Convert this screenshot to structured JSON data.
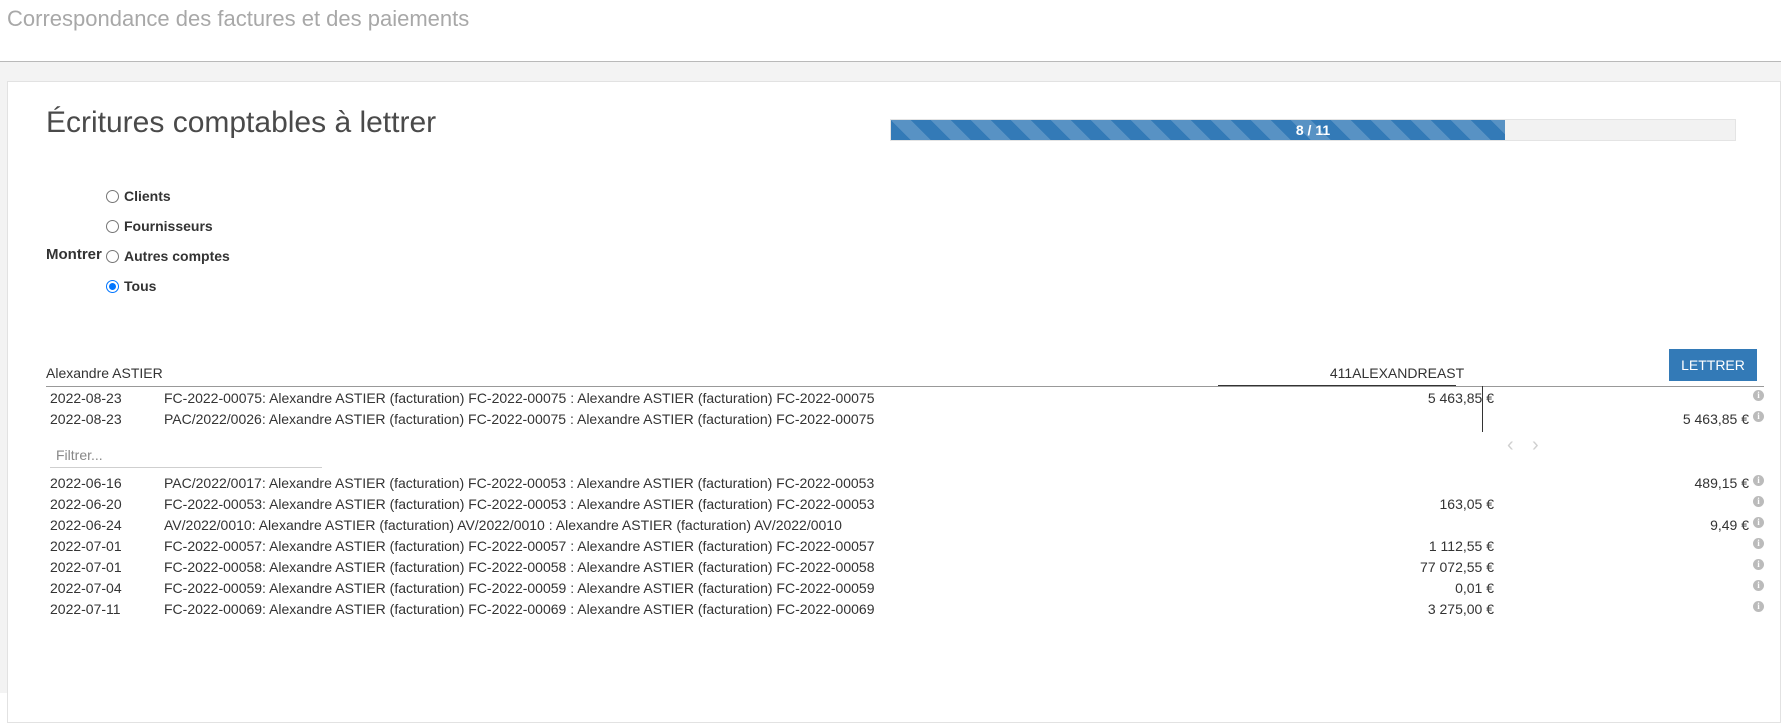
{
  "header": {
    "title": "Correspondance des factures et des paiements"
  },
  "section": {
    "title": "Écritures comptables à lettrer"
  },
  "progress": {
    "label": "8 / 11",
    "current": 8,
    "total": 11,
    "color": "#337ab7"
  },
  "filter_show": {
    "label": "Montrer",
    "options": [
      {
        "label": "Clients",
        "checked": false
      },
      {
        "label": "Fournisseurs",
        "checked": false
      },
      {
        "label": "Autres comptes",
        "checked": false
      },
      {
        "label": "Tous",
        "checked": true
      }
    ]
  },
  "account": {
    "partner": "Alexandre ASTIER",
    "code": "411ALEXANDREAST",
    "reconcile_button": "LETTRER"
  },
  "matched_lines": [
    {
      "date": "2022-08-23",
      "description": "FC-2022-00075: Alexandre ASTIER (facturation) FC-2022-00075 : Alexandre ASTIER (facturation) FC-2022-00075",
      "debit": "5 463,85 €",
      "credit": ""
    },
    {
      "date": "2022-08-23",
      "description": "PAC/2022/0026: Alexandre ASTIER (facturation) FC-2022-00075 : Alexandre ASTIER (facturation) FC-2022-00075",
      "debit": "",
      "credit": "5 463,85 €"
    }
  ],
  "search": {
    "placeholder": "Filtrer..."
  },
  "pager": {
    "prev_icon": "chevron-left-icon",
    "next_icon": "chevron-right-icon"
  },
  "proposed_lines": [
    {
      "date": "2022-06-16",
      "description": "PAC/2022/0017: Alexandre ASTIER (facturation) FC-2022-00053 : Alexandre ASTIER (facturation) FC-2022-00053",
      "debit": "",
      "credit": "489,15 €"
    },
    {
      "date": "2022-06-20",
      "description": "FC-2022-00053: Alexandre ASTIER (facturation) FC-2022-00053 : Alexandre ASTIER (facturation) FC-2022-00053",
      "debit": "163,05 €",
      "credit": ""
    },
    {
      "date": "2022-06-24",
      "description": "AV/2022/0010: Alexandre ASTIER (facturation) AV/2022/0010 : Alexandre ASTIER (facturation) AV/2022/0010",
      "debit": "",
      "credit": "9,49 €"
    },
    {
      "date": "2022-07-01",
      "description": "FC-2022-00057: Alexandre ASTIER (facturation) FC-2022-00057 : Alexandre ASTIER (facturation) FC-2022-00057",
      "debit": "1 112,55 €",
      "credit": ""
    },
    {
      "date": "2022-07-01",
      "description": "FC-2022-00058: Alexandre ASTIER (facturation) FC-2022-00058 : Alexandre ASTIER (facturation) FC-2022-00058",
      "debit": "77 072,55 €",
      "credit": ""
    },
    {
      "date": "2022-07-04",
      "description": "FC-2022-00059: Alexandre ASTIER (facturation) FC-2022-00059 : Alexandre ASTIER (facturation) FC-2022-00059",
      "debit": "0,01 €",
      "credit": ""
    },
    {
      "date": "2022-07-11",
      "description": "FC-2022-00069: Alexandre ASTIER (facturation) FC-2022-00069 : Alexandre ASTIER (facturation) FC-2022-00069",
      "debit": "3 275,00 €",
      "credit": ""
    }
  ]
}
